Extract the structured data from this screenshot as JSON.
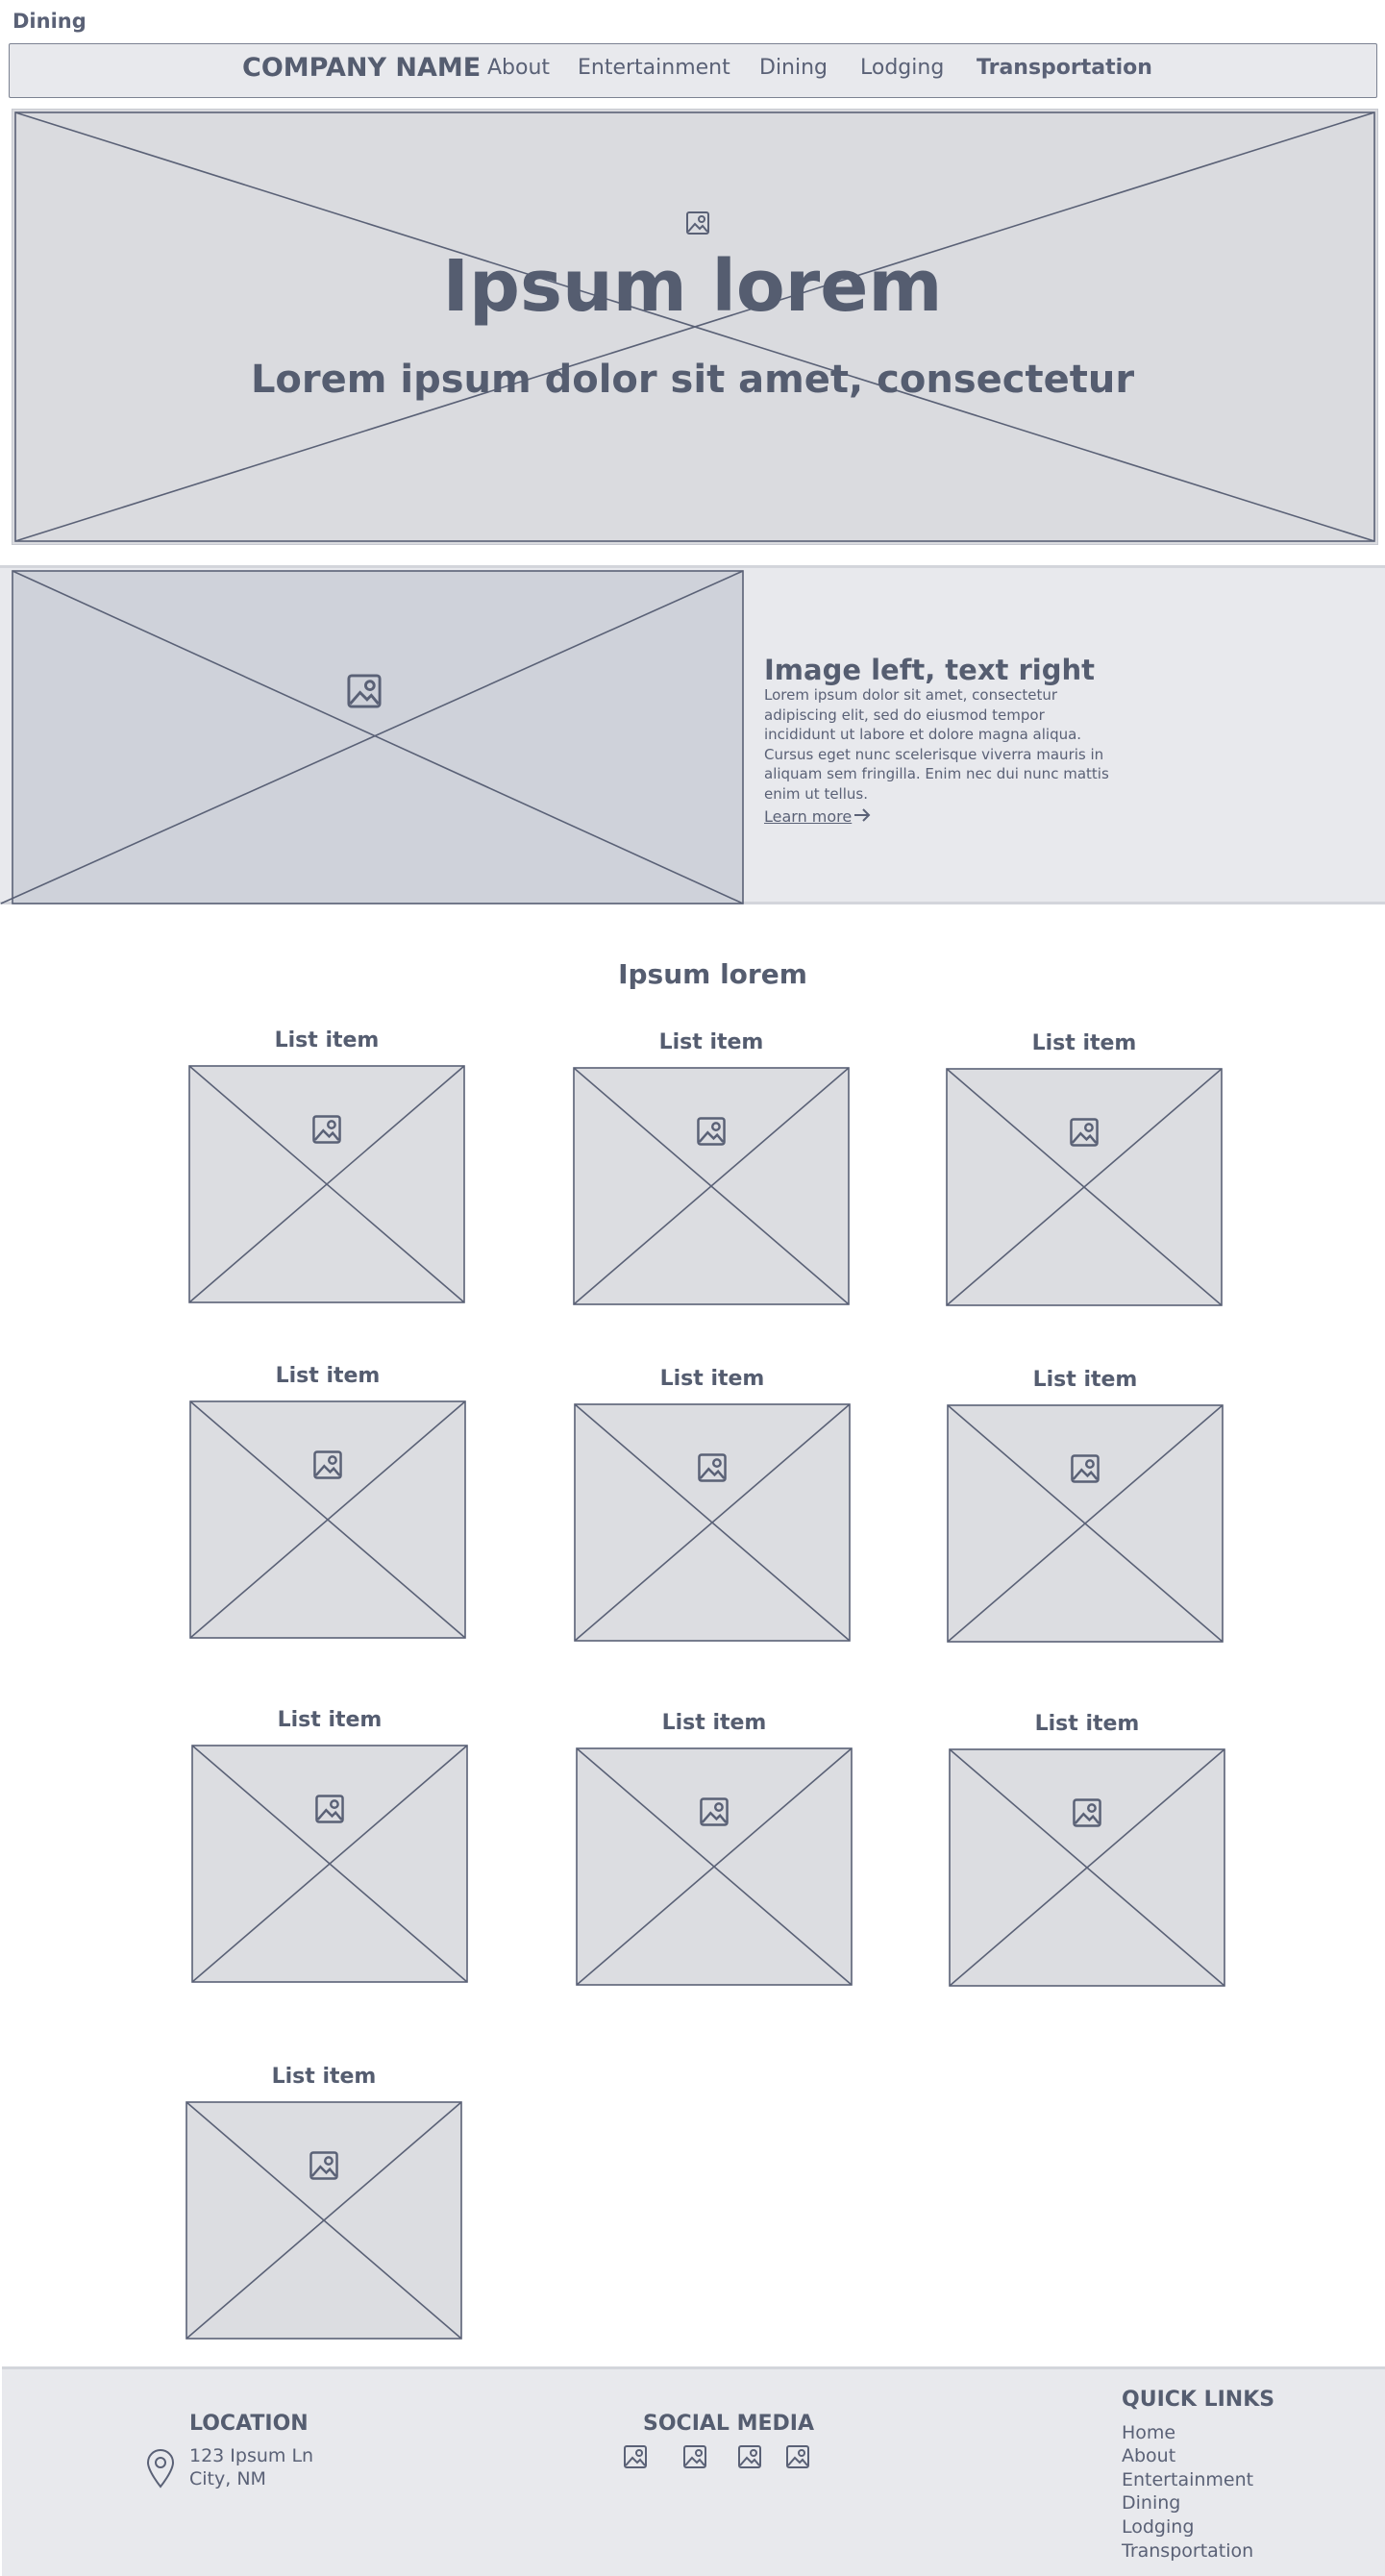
{
  "page_label": "Dining",
  "nav": {
    "brand": "COMPANY NAME",
    "links": [
      "About",
      "Entertainment",
      "Dining",
      "Lodging",
      "Transportation"
    ]
  },
  "hero": {
    "title": "Ipsum lorem",
    "subtitle": "Lorem ipsum dolor sit amet, consectetur",
    "icon": "image-icon"
  },
  "feature": {
    "heading": "Image left, text right",
    "body": "Lorem ipsum dolor sit amet, consectetur adipiscing elit, sed do eiusmod tempor incididunt ut labore et dolore magna aliqua. Cursus eget nunc scelerisque viverra mauris in aliquam sem fringilla. Enim nec dui nunc mattis enim ut tellus.",
    "link": "Learn more",
    "icon": "image-icon",
    "link_icon": "arrow-right-icon"
  },
  "list_section": {
    "title": "Ipsum lorem",
    "items": [
      {
        "label": "List item"
      },
      {
        "label": "List item"
      },
      {
        "label": "List item"
      },
      {
        "label": "List item"
      },
      {
        "label": "List item"
      },
      {
        "label": "List item"
      },
      {
        "label": "List item"
      },
      {
        "label": "List item"
      },
      {
        "label": "List item"
      },
      {
        "label": "List item"
      }
    ]
  },
  "footer": {
    "location": {
      "heading": "LOCATION",
      "line1": "123  Ipsum Ln",
      "line2": "City, NM",
      "icon": "map-pin-icon"
    },
    "social": {
      "heading": "SOCIAL MEDIA",
      "icons": [
        "image-icon",
        "image-icon",
        "image-icon",
        "image-icon"
      ]
    },
    "quick_links": {
      "heading": "QUICK LINKS",
      "links": [
        "Home",
        "About",
        "Entertainment",
        "Dining",
        "Lodging",
        "Transportation"
      ]
    }
  },
  "colors": {
    "text": "#555d70",
    "stroke": "#5a6176",
    "placeholder": "#dcdde1",
    "band": "#e8e9ed"
  }
}
